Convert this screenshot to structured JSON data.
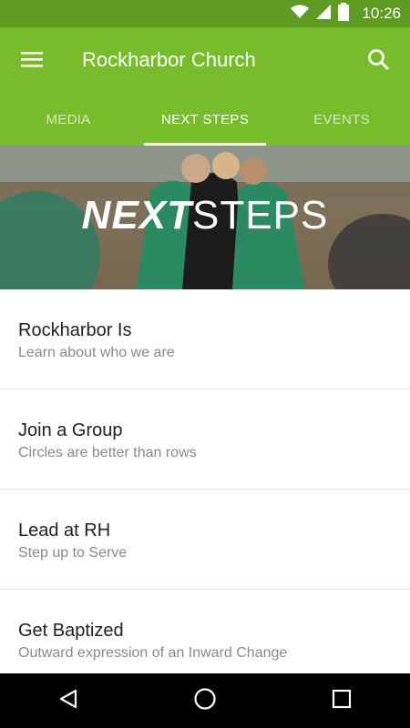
{
  "status_bar": {
    "time": "10:26",
    "icons": [
      "wifi-icon",
      "cellular-signal-icon",
      "battery-icon"
    ]
  },
  "app_bar": {
    "title": "Rockharbor Church",
    "menu_icon": "hamburger-menu-icon",
    "search_icon": "search-icon",
    "color": "#76bc2b"
  },
  "tabs": [
    {
      "label": "MEDIA",
      "active": false
    },
    {
      "label": "NEXT STEPS",
      "active": true
    },
    {
      "label": "EVENTS",
      "active": false
    }
  ],
  "hero": {
    "text_bold": "NEXT",
    "text_light": "STEPS"
  },
  "list": [
    {
      "title": "Rockharbor Is",
      "subtitle": "Learn about who we are"
    },
    {
      "title": "Join a Group",
      "subtitle": "Circles are better than rows"
    },
    {
      "title": "Lead at RH",
      "subtitle": "Step up to Serve"
    },
    {
      "title": "Get Baptized",
      "subtitle": "Outward expression of an Inward Change"
    }
  ],
  "nav_bar": {
    "icons": [
      "back-icon",
      "home-icon",
      "recents-icon"
    ]
  }
}
